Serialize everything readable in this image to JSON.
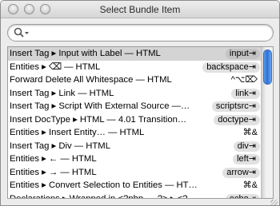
{
  "window": {
    "title": "Select Bundle Item"
  },
  "search": {
    "value": "",
    "placeholder": ""
  },
  "items": [
    {
      "name": "Insert Tag ▸ Input with Label — HTML",
      "trigger": "input⇥",
      "keyequiv": "",
      "selected": true
    },
    {
      "name": "Entities ▸ ⌫ — HTML",
      "trigger": "backspace⇥",
      "keyequiv": "",
      "selected": false
    },
    {
      "name": "Forward Delete All Whitespace — HTML",
      "trigger": "",
      "keyequiv": "^⌥⌦",
      "selected": false
    },
    {
      "name": "Insert Tag ▸ Link — HTML",
      "trigger": "link⇥",
      "keyequiv": "",
      "selected": false
    },
    {
      "name": "Insert Tag ▸ Script With External Source —…",
      "trigger": "scriptsrc⇥",
      "keyequiv": "",
      "selected": false
    },
    {
      "name": "Insert DocType ▸ HTML — 4.01 Transition…",
      "trigger": "doctype⇥",
      "keyequiv": "",
      "selected": false
    },
    {
      "name": "Entities ▸ Insert Entity… — HTML",
      "trigger": "",
      "keyequiv": "⌘&",
      "selected": false
    },
    {
      "name": "Insert Tag ▸ Div — HTML",
      "trigger": "div⇥",
      "keyequiv": "",
      "selected": false
    },
    {
      "name": "Entities ▸ ← — HTML",
      "trigger": "left⇥",
      "keyequiv": "",
      "selected": false
    },
    {
      "name": "Entities ▸ → — HTML",
      "trigger": "arrow⇥",
      "keyequiv": "",
      "selected": false
    },
    {
      "name": "Entities ▸ Convert Selection to Entities — HTML",
      "trigger": "",
      "keyequiv": "⌘&",
      "selected": false
    },
    {
      "name": "Declarations ▸ Wrapped in <?php … ?> ▸ <?p…",
      "trigger": "echo⇥",
      "keyequiv": "",
      "selected": false
    }
  ],
  "icons": {
    "search": "search-icon",
    "scroll_thumb": "scroll-thumb",
    "resize": "resize-grip-icon"
  },
  "colors": {
    "selection": "#d4d4d4",
    "trigger_pill": "#e1e1e1",
    "scroll_thumb": "#2d6fd8"
  }
}
